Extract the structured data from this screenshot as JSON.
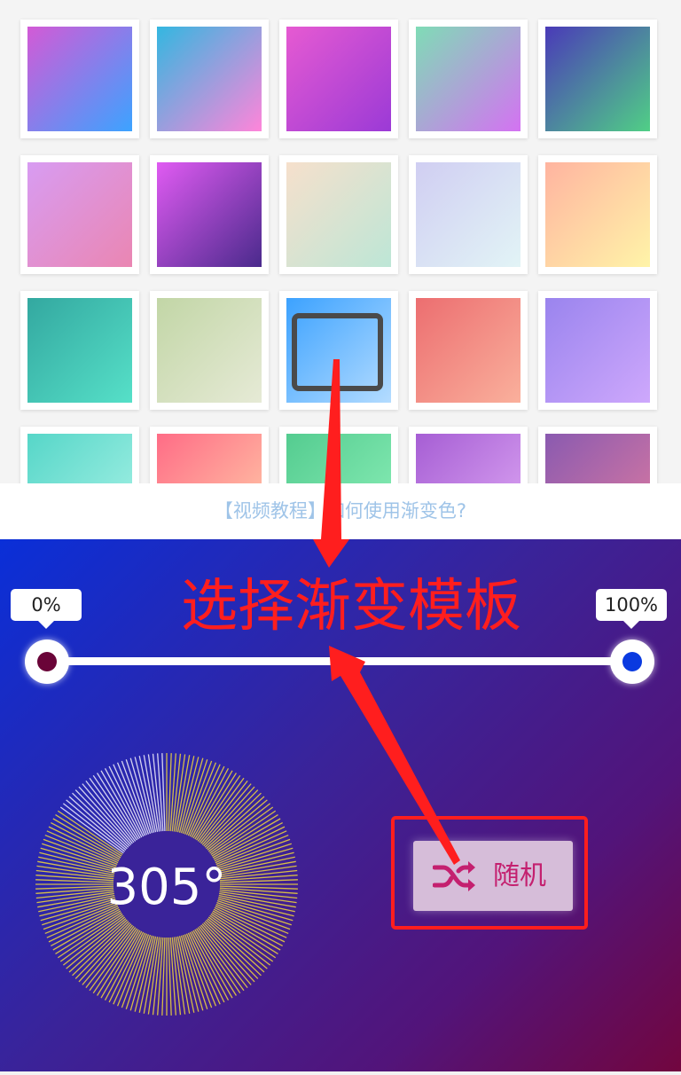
{
  "template_panel": {
    "swatches": [
      {
        "from": "#d35ad6",
        "to": "#3ca3ff"
      },
      {
        "from": "#33b7e0",
        "to": "#ff85da"
      },
      {
        "from": "#e65ad2",
        "to": "#9b3ad6"
      },
      {
        "from": "#7fdcb6",
        "to": "#d472f2"
      },
      {
        "from": "#4a3ab8",
        "to": "#50cf86"
      },
      {
        "from": "#d89cf2",
        "to": "#ea86b2"
      },
      {
        "from": "#e05bf2",
        "to": "#4a2a8c"
      },
      {
        "from": "#f6e0cc",
        "to": "#bde6d6"
      },
      {
        "from": "#d0cef2",
        "to": "#e2f4f6"
      },
      {
        "from": "#ffb4a0",
        "to": "#fff4a8"
      },
      {
        "from": "#33a8a0",
        "to": "#56e0c8"
      },
      {
        "from": "#c2d6a6",
        "to": "#e6ead6"
      },
      {
        "from": "#3ca2ff",
        "to": "#b4dcff"
      },
      {
        "from": "#ec6e70",
        "to": "#fab09c"
      },
      {
        "from": "#9a84ee",
        "to": "#cea8fc"
      },
      {
        "from": "#56d6c8",
        "to": "#a8f2e6"
      },
      {
        "from": "#ff6c86",
        "to": "#ffcca8"
      },
      {
        "from": "#54cc90",
        "to": "#8cefb8"
      },
      {
        "from": "#a65ed4",
        "to": "#dea8f4"
      },
      {
        "from": "#8a5ab0",
        "to": "#dc7aa0"
      }
    ]
  },
  "tutorial_link": {
    "label": "【视频教程】如何使用渐变色?"
  },
  "annotation": {
    "title": "选择渐变模板",
    "color": "#ff1e1e"
  },
  "gradient_editor": {
    "background_colors": [
      "#0a2fd8",
      "#3a2399",
      "#52147a",
      "#72063f"
    ],
    "stops": [
      {
        "label": "0%",
        "color": "#6a0438"
      },
      {
        "label": "100%",
        "color": "#0a3ae0"
      }
    ],
    "angle_label": "305°",
    "angle_value": 305,
    "random_button": {
      "label": "随机",
      "icon": "shuffle-icon"
    }
  }
}
